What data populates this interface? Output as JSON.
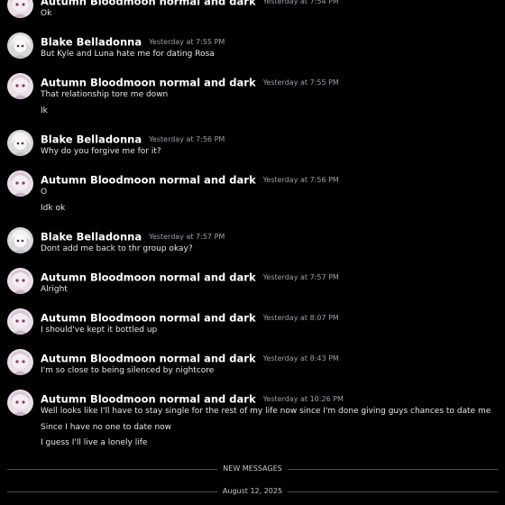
{
  "messages": [
    {
      "user": "Autumn Bloodmoon normal and dark",
      "avatar": "autumn",
      "time": "Yesterday at 7:54 PM",
      "lines": [
        "Ok"
      ]
    },
    {
      "user": "Blake Belladonna",
      "avatar": "blake",
      "time": "Yesterday at 7:55 PM",
      "lines": [
        "But Kyle and Luna hate me for dating Rosa"
      ]
    },
    {
      "user": "Autumn Bloodmoon normal and dark",
      "avatar": "autumn",
      "time": "Yesterday at 7:55 PM",
      "lines": [
        "That relationship tore me down",
        "Ik"
      ]
    },
    {
      "user": "Blake Belladonna",
      "avatar": "blake",
      "time": "Yesterday at 7:56 PM",
      "lines": [
        "Why do you forgive me for it?"
      ]
    },
    {
      "user": "Autumn Bloodmoon normal and dark",
      "avatar": "autumn",
      "time": "Yesterday at 7:56 PM",
      "lines": [
        "O",
        "Idk ok"
      ]
    },
    {
      "user": "Blake Belladonna",
      "avatar": "blake",
      "time": "Yesterday at 7:57 PM",
      "lines": [
        "Dont add me back to thr group okay?"
      ]
    },
    {
      "user": "Autumn Bloodmoon normal and dark",
      "avatar": "autumn",
      "time": "Yesterday at 7:57 PM",
      "lines": [
        "Alright"
      ]
    },
    {
      "user": "Autumn Bloodmoon normal and dark",
      "avatar": "autumn",
      "time": "Yesterday at 8:07 PM",
      "lines": [
        "I should've kept it bottled up"
      ]
    },
    {
      "user": "Autumn Bloodmoon normal and dark",
      "avatar": "autumn",
      "time": "Yesterday at 8:43 PM",
      "lines": [
        "I'm so close to being silenced by nightcore"
      ]
    },
    {
      "user": "Autumn Bloodmoon normal and dark",
      "avatar": "autumn",
      "time": "Yesterday at 10:26 PM",
      "lines": [
        "Well looks like I'll have to stay single for the rest of my life now since I'm done giving guys chances to date me",
        "Since I have no one to date now",
        "I guess I'll live a lonely life"
      ]
    }
  ],
  "dividers": {
    "new_messages": "NEW MESSAGES",
    "date": "August 12, 2025"
  },
  "colors": {
    "background": "#000000",
    "username": "#ffffff",
    "timestamp": "#9aa0a8",
    "text": "#e6e6e6",
    "divider": "#4a4d55"
  }
}
